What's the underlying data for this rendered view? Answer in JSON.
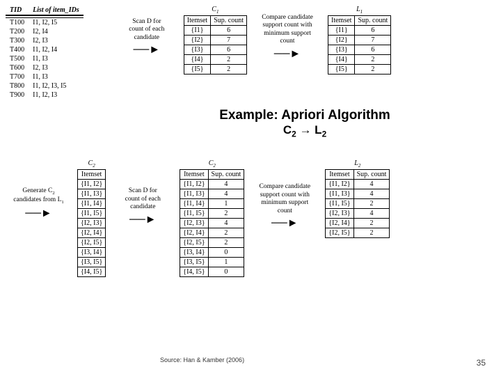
{
  "tx": {
    "h1": "TID",
    "h2": "List of item_IDs",
    "r": [
      [
        "T100",
        "I1, I2, I5"
      ],
      [
        "T200",
        "I2, I4"
      ],
      [
        "T300",
        "I2, I3"
      ],
      [
        "T400",
        "I1, I2, I4"
      ],
      [
        "T500",
        "I1, I3"
      ],
      [
        "T600",
        "I2, I3"
      ],
      [
        "T700",
        "I1, I3"
      ],
      [
        "T800",
        "I1, I2, I3, I5"
      ],
      [
        "T900",
        "I1, I2, I3"
      ]
    ]
  },
  "step1": {
    "l1": "Scan D for",
    "l2": "count of each",
    "l3": "candidate"
  },
  "C1": {
    "cap": "C",
    "sub": "1",
    "h1": "Itemset",
    "h2": "Sup. count",
    "r": [
      [
        "{I1}",
        "6"
      ],
      [
        "{I2}",
        "7"
      ],
      [
        "{I3}",
        "6"
      ],
      [
        "{I4}",
        "2"
      ],
      [
        "{I5}",
        "2"
      ]
    ]
  },
  "step2": {
    "l1": "Compare candidate",
    "l2": "support count with",
    "l3": "minimum support",
    "l4": "count"
  },
  "L1": {
    "cap": "L",
    "sub": "1",
    "h1": "Itemset",
    "h2": "Sup. count",
    "r": [
      [
        "{I1}",
        "6"
      ],
      [
        "{I2}",
        "7"
      ],
      [
        "{I3}",
        "6"
      ],
      [
        "{I4}",
        "2"
      ],
      [
        "{I5}",
        "2"
      ]
    ]
  },
  "title": "Example: Apriori Algorithm",
  "subtitle_c": "C",
  "subtitle_2a": "2",
  "subtitle_arrow": " → ",
  "subtitle_l": "L",
  "subtitle_2b": "2",
  "gen": {
    "l1": "Generate C",
    "l1sub": "2",
    "l2": "candidates from L",
    "l2sub": "1"
  },
  "C2a": {
    "cap": "C",
    "sub": "2",
    "h": "Itemset",
    "r": [
      "{I1, I2}",
      "{I1, I3}",
      "{I1, I4}",
      "{I1, I5}",
      "{I2, I3}",
      "{I2, I4}",
      "{I2, I5}",
      "{I3, I4}",
      "{I3, I5}",
      "{I4, I5}"
    ]
  },
  "step3": {
    "l1": "Scan D for",
    "l2": "count of each",
    "l3": "candidate"
  },
  "C2b": {
    "cap": "C",
    "sub": "2",
    "h1": "Itemset",
    "h2": "Sup. count",
    "r": [
      [
        "{I1, I2}",
        "4"
      ],
      [
        "{I1, I3}",
        "4"
      ],
      [
        "{I1, I4}",
        "1"
      ],
      [
        "{I1, I5}",
        "2"
      ],
      [
        "{I2, I3}",
        "4"
      ],
      [
        "{I2, I4}",
        "2"
      ],
      [
        "{I2, I5}",
        "2"
      ],
      [
        "{I3, I4}",
        "0"
      ],
      [
        "{I3, I5}",
        "1"
      ],
      [
        "{I4, I5}",
        "0"
      ]
    ]
  },
  "step4": {
    "l1": "Compare candidate",
    "l2": "support count with",
    "l3": "minimum support",
    "l4": "count"
  },
  "L2": {
    "cap": "L",
    "sub": "2",
    "h1": "Itemset",
    "h2": "Sup. count",
    "r": [
      [
        "{I1, I2}",
        "4"
      ],
      [
        "{I1, I3}",
        "4"
      ],
      [
        "{I1, I5}",
        "2"
      ],
      [
        "{I2, I3}",
        "4"
      ],
      [
        "{I2, I4}",
        "2"
      ],
      [
        "{I2, I5}",
        "2"
      ]
    ]
  },
  "source": "Source: Han & Kamber (2006)",
  "page": "35"
}
